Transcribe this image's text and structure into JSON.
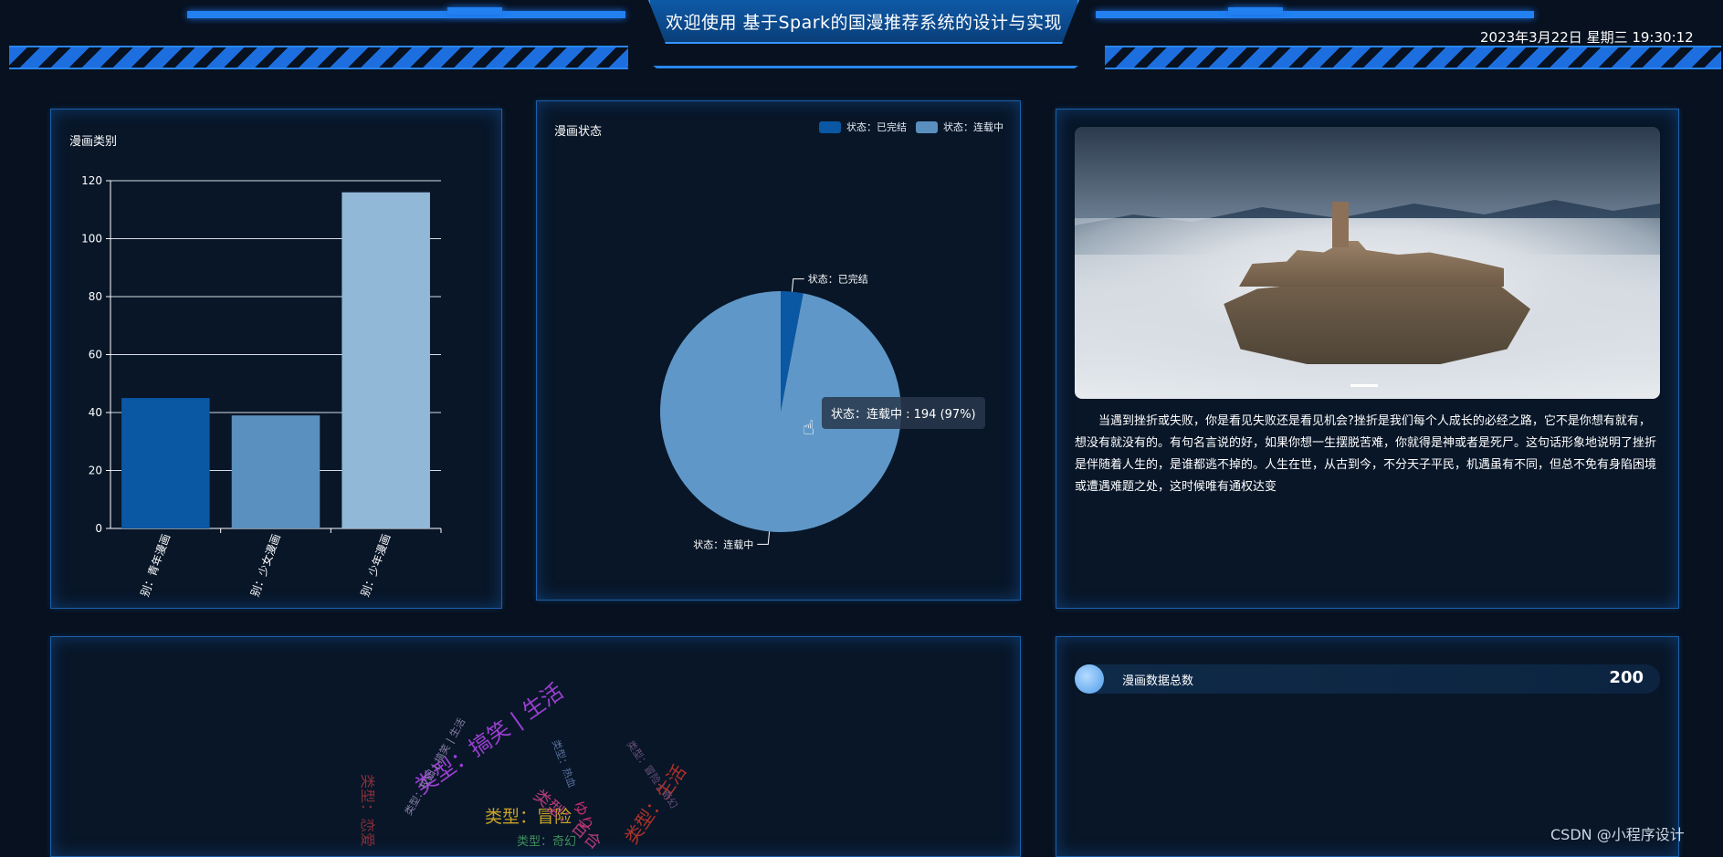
{
  "header": {
    "title": "欢迎使用 基于Spark的国漫推荐系统的设计与实现",
    "datetime": "2023年3月22日 星期三 19:30:12"
  },
  "category_panel": {
    "title": "漫画类别",
    "chart_data": {
      "type": "bar",
      "categories": [
        "类别：青年漫画",
        "类别：少女漫画",
        "类别：少年漫画"
      ],
      "visible_tick_labels": [
        "别：青年漫画",
        "别：少女漫画",
        "别：少年漫画"
      ],
      "values": [
        45,
        39,
        116
      ],
      "colors": [
        "#0a57a3",
        "#5a90bf",
        "#92b8d8"
      ],
      "ylim": [
        0,
        120
      ],
      "yticks": [
        0,
        20,
        40,
        60,
        80,
        100,
        120
      ],
      "grid": true
    }
  },
  "status_panel": {
    "title": "漫画状态",
    "legend": [
      {
        "label": "状态：已完结",
        "color": "#0a57a3"
      },
      {
        "label": "状态：连载中",
        "color": "#5a90bf"
      }
    ],
    "chart_data": {
      "type": "pie",
      "labels": [
        "状态：已完结",
        "状态：连载中"
      ],
      "values": [
        6,
        194
      ],
      "colors": [
        "#0a57a3",
        "#5f98c8"
      ],
      "legend_position": "top-right"
    },
    "tooltip": "状态：连载中 : 194 (97%)"
  },
  "article_panel": {
    "text": "当遇到挫折或失败，你是看见失败还是看见机会?挫折是我们每个人成长的必经之路，它不是你想有就有，想没有就没有的。有句名言说的好，如果你想一生摆脱苦难，你就得是神或者是死尸。这句话形象地说明了挫折是伴随着人生的，是谁都逃不掉的。人生在世，从古到今，不分天子平民，机遇虽有不同，但总不免有身陷困境或遭遇难题之处，这时候唯有通权达变"
  },
  "total_panel": {
    "label": "漫画数据总数",
    "value": "200"
  },
  "word_cloud": {
    "words": [
      {
        "text": "类型：搞笑 | 生活",
        "color": "#9b3fd1"
      },
      {
        "text": "类型：冒险",
        "color": "#c9a227"
      },
      {
        "text": "类型：生活",
        "color": "#b0322a"
      },
      {
        "text": "类型：百合",
        "color": "#b23a7a"
      },
      {
        "text": "ゆり",
        "color": "#c02f6b"
      },
      {
        "text": "类型：奇幻",
        "color": "#3f8f5a"
      },
      {
        "text": "类型：校园 | 搞笑 | 生活",
        "color": "#8a7fa8"
      },
      {
        "text": "类型：热血",
        "color": "#5a6f9a"
      },
      {
        "text": "类型：冒险 | 奇幻",
        "color": "#6b4f7a"
      },
      {
        "text": "类型：恋爱",
        "color": "#8b2f3a"
      }
    ]
  },
  "watermark": "CSDN @小程序设计"
}
